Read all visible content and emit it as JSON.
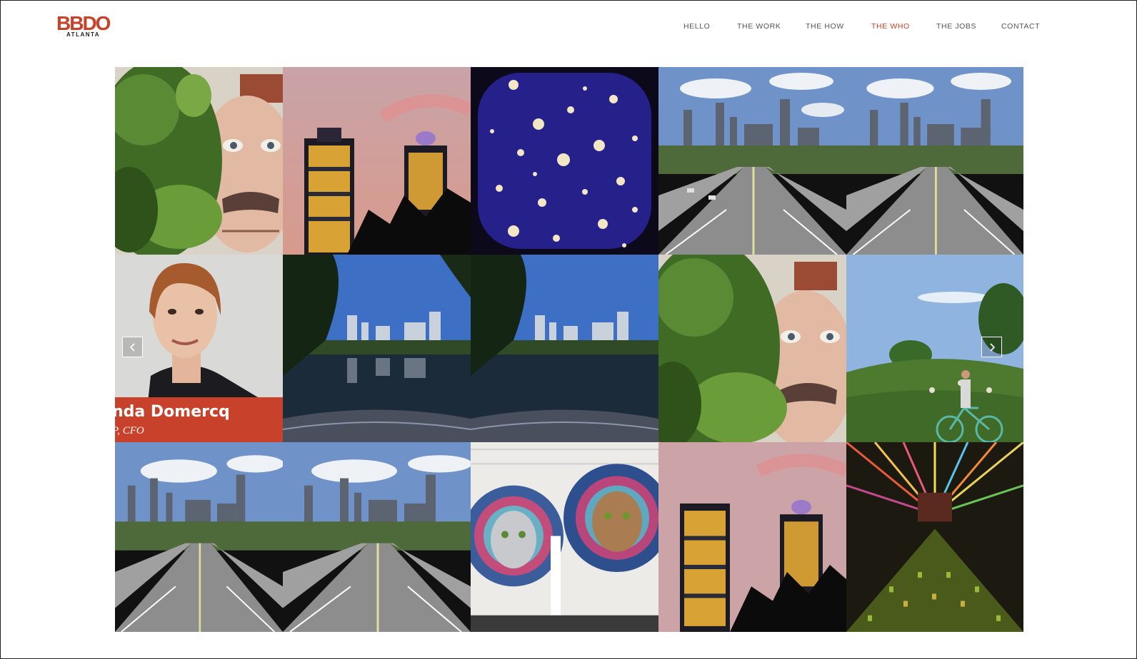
{
  "brand": {
    "logo_main": "BBDO",
    "logo_sub": "ATLANTA",
    "accent_color": "#c8412a"
  },
  "nav": {
    "items": [
      {
        "label": "HELLO"
      },
      {
        "label": "THE WORK"
      },
      {
        "label": "THE HOW"
      },
      {
        "label": "THE WHO"
      },
      {
        "label": "THE JOBS"
      },
      {
        "label": "CONTACT"
      }
    ],
    "active": "THE WHO"
  },
  "gallery": {
    "tiles": [
      "mural-portrait",
      "skyline-dusk",
      "jellyfish",
      "highway-skyline",
      "highway-skyline",
      "person-portrait",
      "lake-skyline",
      "lake-skyline",
      "mural-portrait",
      "park-cyclist",
      "highway-skyline",
      "highway-skyline",
      "cat-mural",
      "skyline-dusk",
      "light-installation"
    ],
    "featured": {
      "name": "nda Domercq",
      "role": "P, CFO"
    },
    "prev_icon": "chevron-left-icon",
    "next_icon": "chevron-right-icon"
  }
}
